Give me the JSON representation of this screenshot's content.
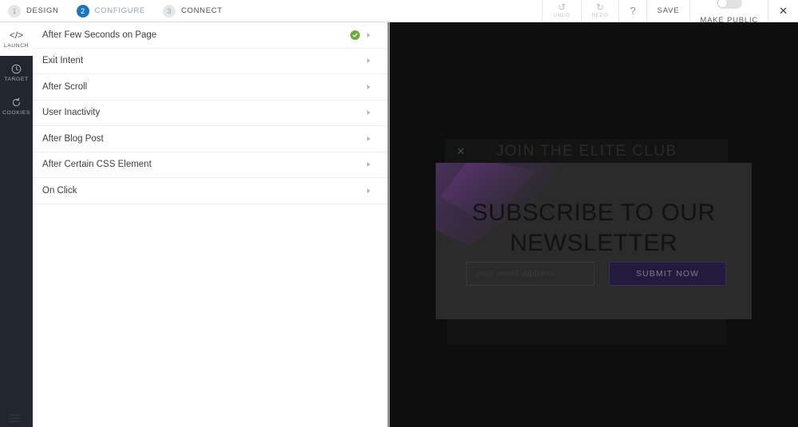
{
  "topbar": {
    "steps": [
      {
        "num": "1",
        "label": "DESIGN",
        "active": false
      },
      {
        "num": "2",
        "label": "CONFIGURE",
        "active": true
      },
      {
        "num": "3",
        "label": "CONNECT",
        "active": false
      }
    ],
    "undo_label": "UNDO",
    "redo_label": "REDO",
    "help_label": "?",
    "save_label": "SAVE",
    "make_public_label": "MAKE PUBLIC",
    "make_public_on": false,
    "close_label": "✕",
    "accent_color": "#1b75bb"
  },
  "rail": {
    "items": [
      {
        "label": "LAUNCH",
        "icon": "code-icon",
        "active": true
      },
      {
        "label": "TARGET",
        "icon": "clock-icon",
        "active": false
      },
      {
        "label": "COOKIES",
        "icon": "refresh-icon",
        "active": false
      }
    ]
  },
  "triggers": {
    "rows": [
      {
        "label": "After Few Seconds on Page",
        "enabled": true
      },
      {
        "label": "Exit Intent",
        "enabled": false
      },
      {
        "label": "After Scroll",
        "enabled": false
      },
      {
        "label": "User Inactivity",
        "enabled": false
      },
      {
        "label": "After Blog Post",
        "enabled": false
      },
      {
        "label": "After Certain CSS Element",
        "enabled": false
      },
      {
        "label": "On Click",
        "enabled": false
      }
    ],
    "enabled_color": "#6aab3c"
  },
  "preview": {
    "header_title": "JOIN THE ELITE CLUB",
    "header_close": "✕",
    "popup_title_line1": "SUBSCRIBE TO OUR",
    "popup_title_line2": "NEWSLETTER",
    "email_placeholder": "your email address",
    "email_value": "",
    "submit_label": "SUBMIT NOW",
    "submit_color": "#241a3d"
  }
}
